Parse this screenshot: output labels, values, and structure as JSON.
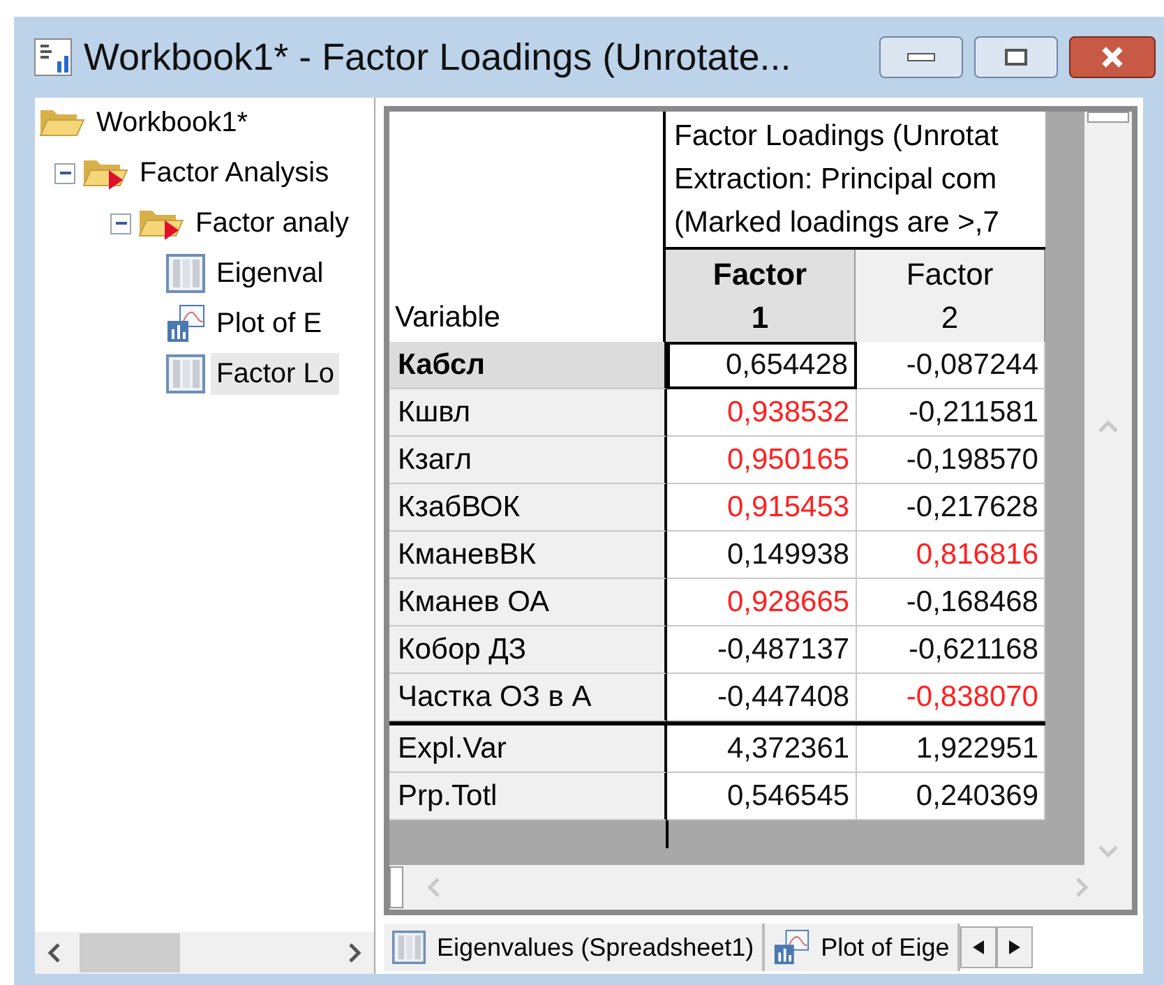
{
  "window": {
    "title": "Workbook1* - Factor Loadings (Unrotate..."
  },
  "tree": [
    {
      "label": "Workbook1*",
      "kind": "folder",
      "selected": false,
      "children": [
        {
          "label": "Factor Analysis",
          "kind": "analysis",
          "selected": false,
          "expanded": true,
          "children": [
            {
              "label": "Factor analy",
              "kind": "analysis",
              "selected": false,
              "expanded": true,
              "children": [
                {
                  "label": "Eigenval",
                  "kind": "sheet",
                  "selected": false
                },
                {
                  "label": "Plot of E",
                  "kind": "graph",
                  "selected": false
                },
                {
                  "label": "Factor Lo",
                  "kind": "sheet",
                  "selected": true
                }
              ]
            }
          ]
        }
      ]
    }
  ],
  "sheet": {
    "title_lines": [
      "Factor Loadings (Unrotat",
      "Extraction: Principal com",
      "(Marked loadings are >,7"
    ],
    "row_header_label": "Variable",
    "columns": [
      {
        "line1": "Factor",
        "line2": "1",
        "selected": true
      },
      {
        "line1": "Factor",
        "line2": "2",
        "selected": false
      }
    ],
    "rows": [
      {
        "name": "Кабсл",
        "selected": true,
        "cells": [
          {
            "value": "0,654428",
            "marked": false,
            "selected": true
          },
          {
            "value": "-0,087244",
            "marked": false,
            "selected": false
          }
        ]
      },
      {
        "name": "Кшвл",
        "selected": false,
        "cells": [
          {
            "value": "0,938532",
            "marked": true,
            "selected": false
          },
          {
            "value": "-0,211581",
            "marked": false,
            "selected": false
          }
        ]
      },
      {
        "name": "Кзагл",
        "selected": false,
        "cells": [
          {
            "value": "0,950165",
            "marked": true,
            "selected": false
          },
          {
            "value": "-0,198570",
            "marked": false,
            "selected": false
          }
        ]
      },
      {
        "name": "КзабВОК",
        "selected": false,
        "cells": [
          {
            "value": "0,915453",
            "marked": true,
            "selected": false
          },
          {
            "value": "-0,217628",
            "marked": false,
            "selected": false
          }
        ]
      },
      {
        "name": "КманевВК",
        "selected": false,
        "cells": [
          {
            "value": "0,149938",
            "marked": false,
            "selected": false
          },
          {
            "value": "0,816816",
            "marked": true,
            "selected": false
          }
        ]
      },
      {
        "name": "Кманев ОА",
        "selected": false,
        "cells": [
          {
            "value": "0,928665",
            "marked": true,
            "selected": false
          },
          {
            "value": "-0,168468",
            "marked": false,
            "selected": false
          }
        ]
      },
      {
        "name": "Кобор ДЗ",
        "selected": false,
        "cells": [
          {
            "value": "-0,487137",
            "marked": false,
            "selected": false
          },
          {
            "value": "-0,621168",
            "marked": false,
            "selected": false
          }
        ]
      },
      {
        "name": "Частка ОЗ в А",
        "selected": false,
        "cells": [
          {
            "value": "-0,447408",
            "marked": false,
            "selected": false
          },
          {
            "value": "-0,838070",
            "marked": true,
            "selected": false
          }
        ]
      }
    ],
    "summary_rows": [
      {
        "name": "Expl.Var",
        "cells": [
          "4,372361",
          "1,922951"
        ]
      },
      {
        "name": "Prp.Totl",
        "cells": [
          "0,546545",
          "0,240369"
        ]
      }
    ]
  },
  "tabs": [
    {
      "label": "Eigenvalues (Spreadsheet1)",
      "kind": "sheet",
      "selected": false
    },
    {
      "label": "Plot of Eige",
      "kind": "graph",
      "selected": false
    }
  ]
}
